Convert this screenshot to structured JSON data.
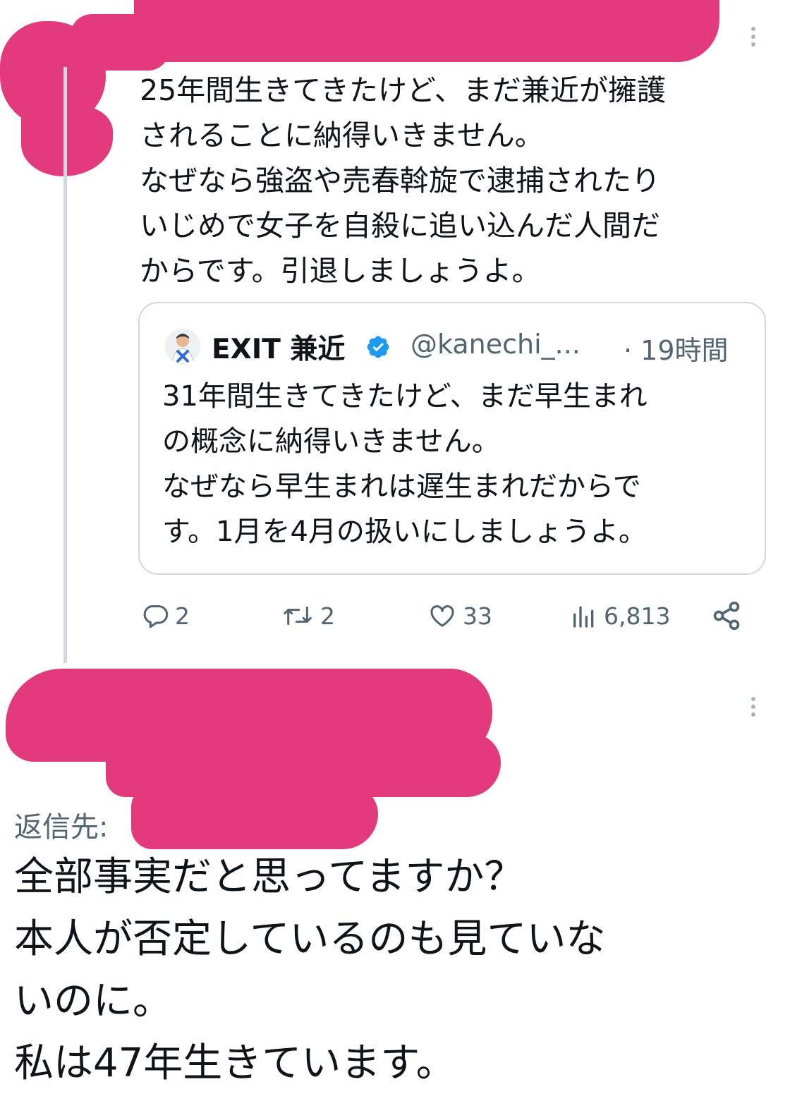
{
  "tweet": {
    "text": "25年間生きてきたけど、まだ兼近が擁護\nされることに納得いきません。\nなぜなら強盗や売春斡旋で逮捕されたり\nいじめで女子を自殺に追い込んだ人間だ\nからです。引退しましょうよ。",
    "quote": {
      "name": "EXIT 兼近",
      "handle": "@kanechi_...",
      "time": "· 19時間",
      "text": "31年間生きてきたけど、まだ早生まれ\nの概念に納得いきません。\nなぜなら早生まれは遅生まれだからで\nす。1月を4月の扱いにしましょうよ。"
    },
    "actions": {
      "replies": "2",
      "retweets": "2",
      "likes": "33",
      "views": "6,813"
    }
  },
  "reply": {
    "reply_to_label": "返信先:",
    "text": "全部事実だと思ってますか？\n本人が否定しているのも見ていな\nいのに。\n私は47年生きています。"
  },
  "colors": {
    "redaction": "#e23a7d",
    "text": "#0f1419",
    "secondary": "#536471",
    "border": "#cfd9de",
    "verified": "#1d9bf0"
  },
  "icons": [
    "more-icon",
    "verified-badge-icon",
    "reply-icon",
    "retweet-icon",
    "like-icon",
    "views-icon",
    "share-icon"
  ]
}
